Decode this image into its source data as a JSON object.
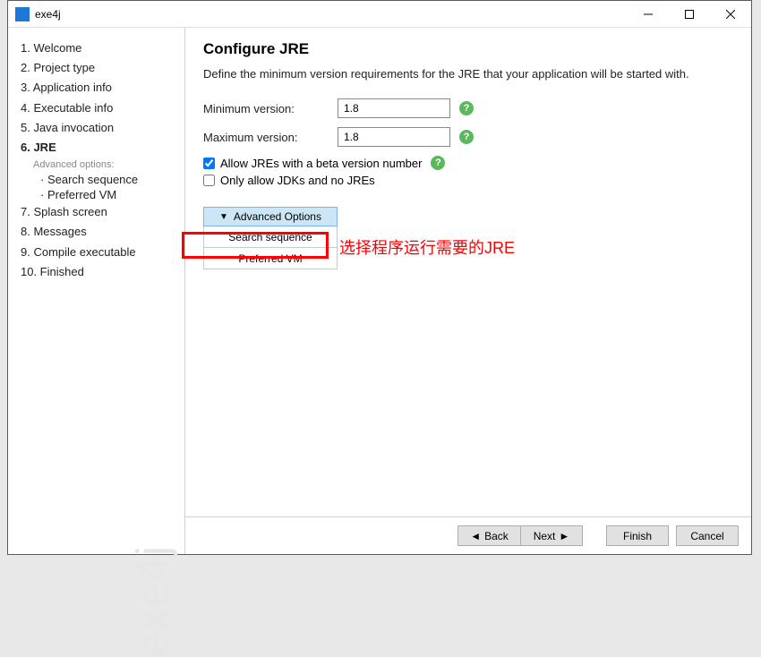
{
  "window": {
    "title": "exe4j"
  },
  "sidebar": {
    "steps": [
      "1. Welcome",
      "2. Project type",
      "3. Application info",
      "4. Executable info",
      "5. Java invocation",
      "6. JRE",
      "7. Splash screen",
      "8. Messages",
      "9. Compile executable",
      "10. Finished"
    ],
    "advanced_label": "Advanced options:",
    "sub_steps": [
      "Search sequence",
      "Preferred VM"
    ],
    "watermark": "exe4j"
  },
  "main": {
    "title": "Configure JRE",
    "description": "Define the minimum version requirements for the JRE that your application will be started with.",
    "min_label": "Minimum version:",
    "min_value": "1.8",
    "max_label": "Maximum version:",
    "max_value": "1.8",
    "allow_beta_label": "Allow JREs with a beta version number",
    "only_jdk_label": "Only allow JDKs and no JREs",
    "adv_header": "Advanced Options",
    "adv_items": [
      "Search sequence",
      "Preferred VM"
    ],
    "annotation": "选择程序运行需要的JRE"
  },
  "footer": {
    "back": "Back",
    "next": "Next",
    "finish": "Finish",
    "cancel": "Cancel"
  }
}
